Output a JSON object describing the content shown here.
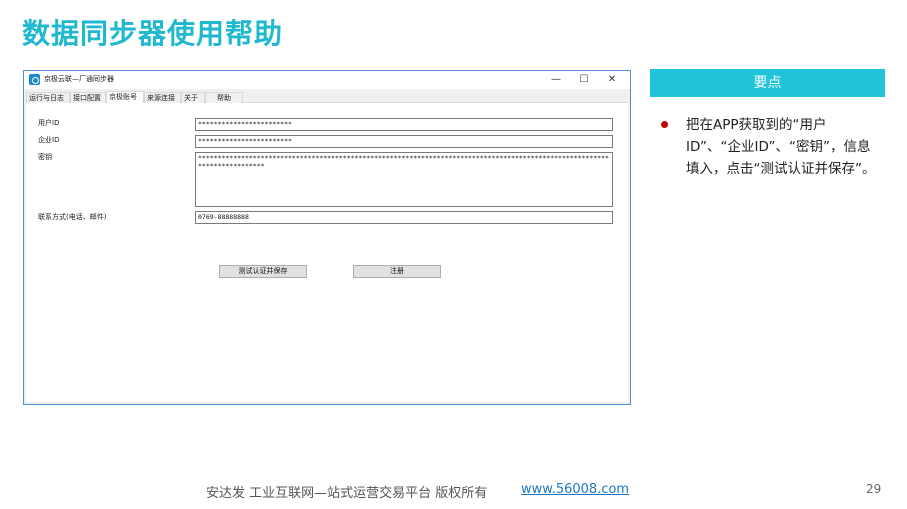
{
  "slide": {
    "title": "数据同步器使用帮助",
    "page_number": "29"
  },
  "window": {
    "title": "京极云联—厂通同步器",
    "controls": {
      "minimize": "—",
      "maximize": "☐",
      "close": "✕"
    },
    "tabs": [
      "运行与日志",
      "接口配置",
      "京极账号",
      "来源连接",
      "关于",
      "帮助"
    ],
    "active_tab": "京极账号"
  },
  "form": {
    "user_id_label": "用户ID",
    "user_id_value": "************************",
    "company_id_label": "企业ID",
    "company_id_value": "************************",
    "secret_label": "密钥",
    "secret_value": "**************************************************************************************************************************",
    "contact_label": "联系方式(电话、邮件)",
    "contact_value": "0769-88888888",
    "test_save_button": "测试认证并保存",
    "register_button": "注册"
  },
  "key_points": {
    "header": "要点",
    "text": "把在APP获取到的“用户ID”、“企业ID”、“密钥”，信息填入，点击“测试认证并保存”。"
  },
  "footer": {
    "company": "安达发   工业互联网—站式运营交易平台   版权所有",
    "link": "www.56008.com"
  },
  "colors": {
    "title": "#1fb8cf",
    "header_bg": "#1fc3da",
    "bullet": "#c00000",
    "link": "#1c78c8",
    "window_border": "#4f8fd4"
  }
}
